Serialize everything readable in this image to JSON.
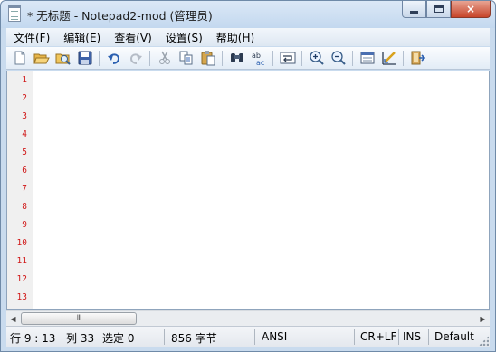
{
  "window": {
    "title": "* 无标题 - Notepad2-mod (管理员)",
    "caption_buttons": {
      "minimize": "minimize",
      "maximize": "maximize",
      "close": "×"
    }
  },
  "menu": {
    "items": [
      "文件(F)",
      "编辑(E)",
      "查看(V)",
      "设置(S)",
      "帮助(H)"
    ]
  },
  "toolbar": {
    "buttons": [
      {
        "icon": "new-file-icon"
      },
      {
        "icon": "open-folder-icon"
      },
      {
        "icon": "browse-icon"
      },
      {
        "icon": "save-icon"
      },
      {
        "icon": "undo-icon"
      },
      {
        "icon": "redo-icon"
      },
      {
        "icon": "cut-icon"
      },
      {
        "icon": "copy-icon"
      },
      {
        "icon": "paste-icon"
      },
      {
        "icon": "find-icon"
      },
      {
        "icon": "replace-icon"
      },
      {
        "icon": "word-wrap-icon"
      },
      {
        "icon": "zoom-in-icon"
      },
      {
        "icon": "zoom-out-icon"
      },
      {
        "icon": "scheme-icon"
      },
      {
        "icon": "customize-icon"
      },
      {
        "icon": "exit-icon"
      }
    ]
  },
  "editor": {
    "line_numbers": [
      "1",
      "2",
      "3",
      "4",
      "5",
      "6",
      "7",
      "8",
      "9",
      "10",
      "11",
      "12",
      "13"
    ]
  },
  "scrollbar": {
    "left_arrow": "◀",
    "right_arrow": "▶",
    "grip": "III"
  },
  "status": {
    "position": "行 9 : 13",
    "column": "列 33",
    "selection": "选定 0",
    "size": "856 字节",
    "encoding": "ANSI",
    "line_endings": "CR+LF",
    "ins_mode": "INS",
    "scheme": "Default"
  },
  "colors": {
    "line_number": "#d01818",
    "title_bar": "#c3d8ef",
    "close_button": "#c7452a"
  }
}
